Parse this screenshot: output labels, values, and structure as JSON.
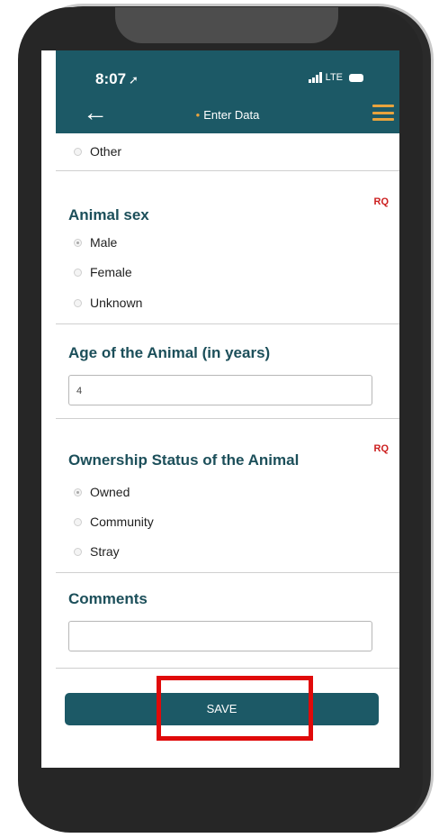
{
  "status_bar": {
    "time": "8:07",
    "location_icon": "location-arrow-icon",
    "network": "LTE",
    "signal_icon": "signal-bars-icon",
    "battery_icon": "battery-icon"
  },
  "nav": {
    "back_icon": "arrow-left-icon",
    "title": "Enter Data",
    "menu_icon": "hamburger-menu-icon",
    "menu_color": "#e8a33d"
  },
  "form": {
    "previous_option": {
      "label": "Other",
      "selected": false
    },
    "animal_sex": {
      "title": "Animal sex",
      "required_badge": "RQ",
      "options": [
        {
          "label": "Male",
          "selected": true
        },
        {
          "label": "Female",
          "selected": false
        },
        {
          "label": "Unknown",
          "selected": false
        }
      ]
    },
    "age": {
      "title": "Age of the Animal (in years)",
      "value": "4"
    },
    "ownership": {
      "title": "Ownership Status of the Animal",
      "required_badge": "RQ",
      "options": [
        {
          "label": "Owned",
          "selected": true
        },
        {
          "label": "Community",
          "selected": false
        },
        {
          "label": "Stray",
          "selected": false
        }
      ]
    },
    "comments": {
      "title": "Comments",
      "value": ""
    }
  },
  "save_button": {
    "label": "SAVE"
  },
  "colors": {
    "header": "#1c5966",
    "accent": "#e8a33d",
    "required": "#cc1f1f",
    "highlight": "#e00a0a"
  }
}
